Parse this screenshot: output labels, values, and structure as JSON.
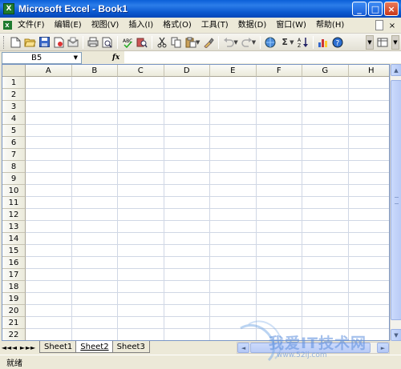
{
  "window": {
    "title": "Microsoft Excel - Book1",
    "app_icon_letter": "X",
    "controls": [
      "_",
      "□",
      "×"
    ]
  },
  "menubar": {
    "items": [
      "文件(F)",
      "编辑(E)",
      "视图(V)",
      "插入(I)",
      "格式(O)",
      "工具(T)",
      "数据(D)",
      "窗口(W)",
      "帮助(H)"
    ],
    "close_glyph": "×"
  },
  "toolbar": {
    "icons": [
      "new-icon",
      "open-icon",
      "save-icon",
      "permission-icon",
      "email-icon",
      "print-icon",
      "print-preview-icon",
      "spelling-icon",
      "research-icon",
      "cut-icon",
      "copy-icon",
      "paste-icon",
      "format-painter-icon",
      "undo-icon",
      "redo-icon",
      "hyperlink-icon",
      "autosum-icon",
      "sort-ascending-icon",
      "chart-wizard-icon",
      "help-icon"
    ],
    "sigma": "Σ"
  },
  "formula_bar": {
    "name_box": "B5",
    "fx_label": "fx",
    "formula": ""
  },
  "sheet": {
    "columns": [
      "A",
      "B",
      "C",
      "D",
      "E",
      "F",
      "G",
      "H"
    ],
    "rows": [
      "1",
      "2",
      "3",
      "4",
      "5",
      "6",
      "7",
      "8",
      "9",
      "10",
      "11",
      "12",
      "13",
      "14",
      "15",
      "16",
      "17",
      "18",
      "19",
      "20",
      "21",
      "22"
    ]
  },
  "tabs": {
    "nav": [
      "◄◄",
      "◄",
      "►",
      "►►"
    ],
    "sheets": [
      "Sheet1",
      "Sheet2",
      "Sheet3"
    ],
    "active_index": 1
  },
  "status": {
    "text": "就绪"
  },
  "watermark": {
    "text": "我爱IT技术网",
    "sub": "www.52ij.com"
  }
}
